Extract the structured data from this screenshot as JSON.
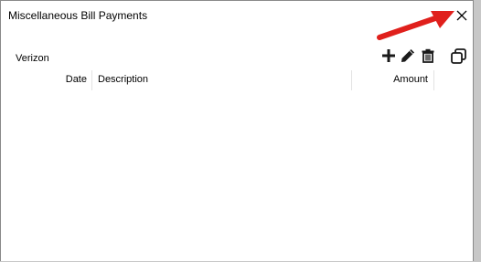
{
  "window": {
    "title": "Miscellaneous Bill Payments"
  },
  "account": {
    "name": "Verizon"
  },
  "toolbar": {
    "add_icon": "plus-icon",
    "edit_icon": "pencil-icon",
    "delete_icon": "trash-icon",
    "copy_icon": "copy-icon"
  },
  "table": {
    "columns": [
      "Date",
      "Description",
      "Amount"
    ],
    "rows": []
  },
  "colors": {
    "annotation_arrow": "#e0201c",
    "window_background": "#ffffff",
    "outer_background": "#c7c7c7"
  }
}
